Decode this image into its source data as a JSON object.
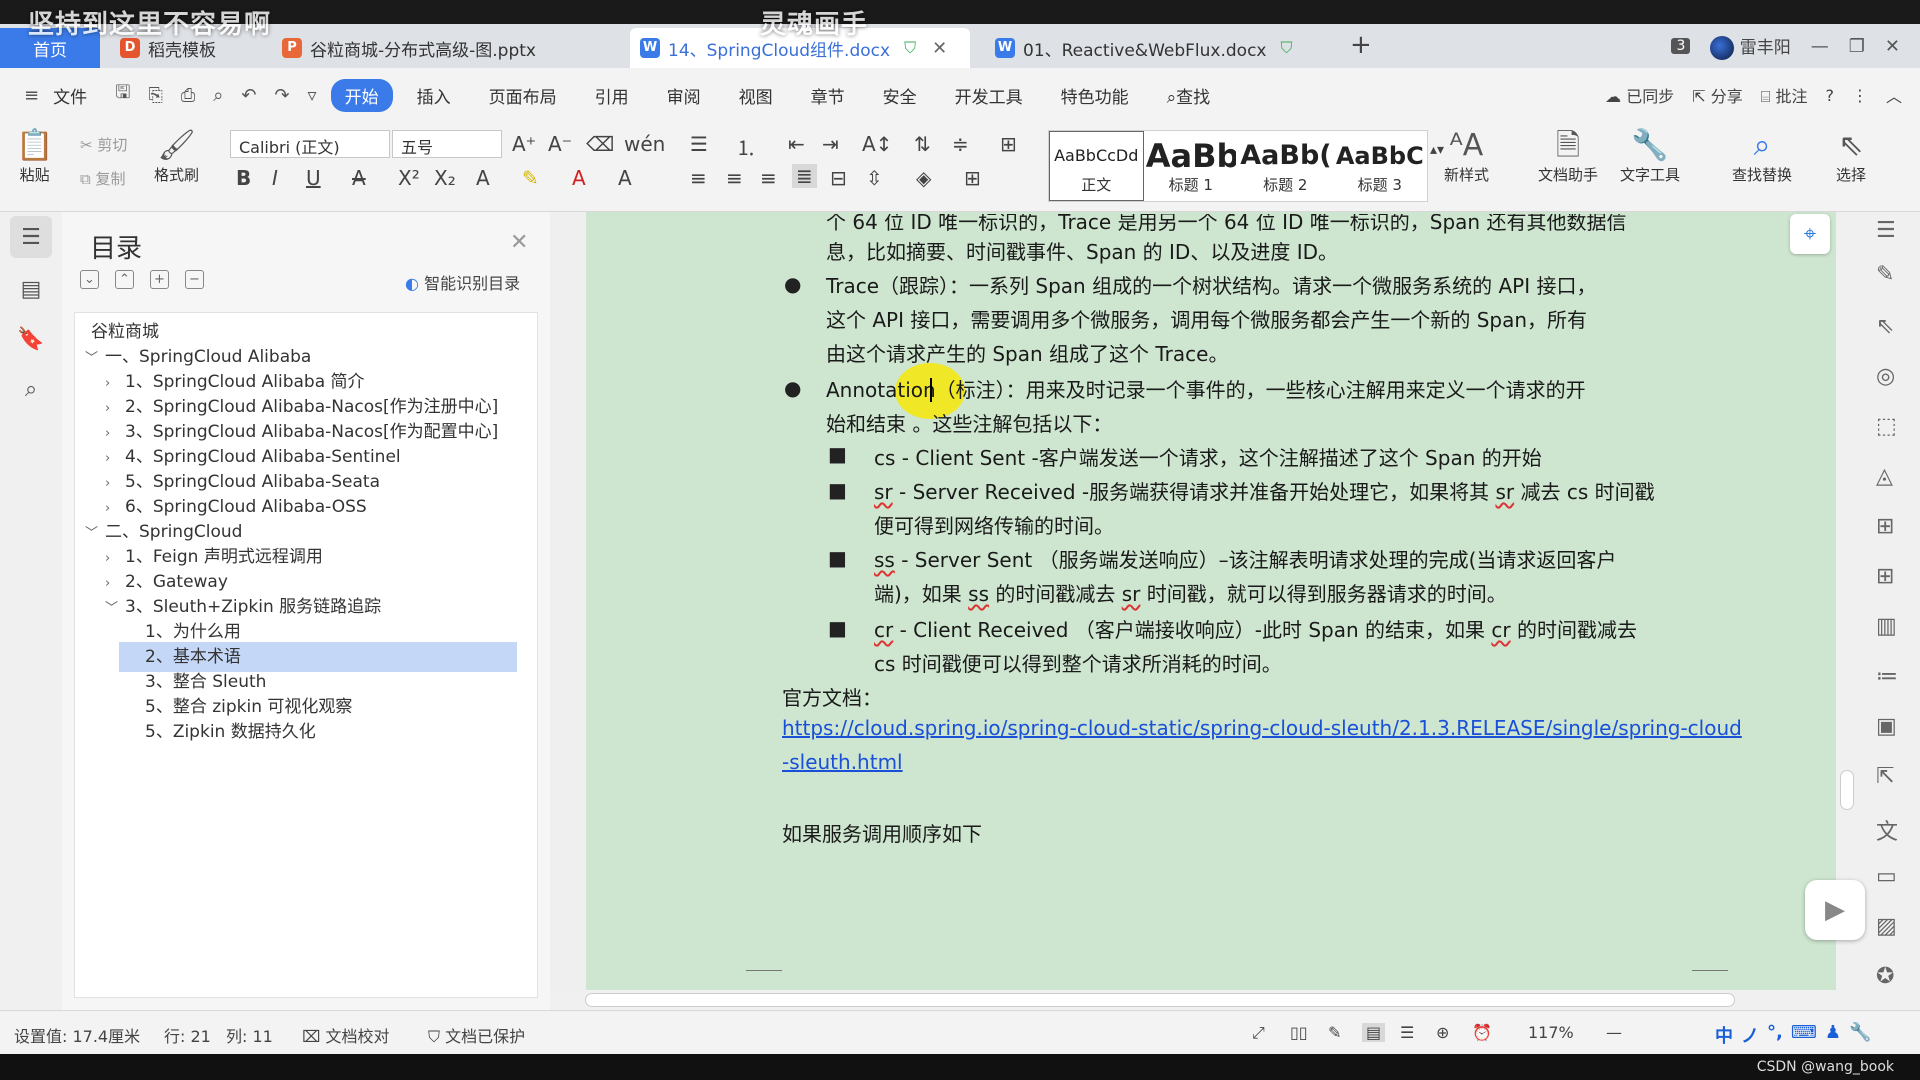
{
  "overlay": {
    "left_text": "坚持到这里不容易啊",
    "center_text": "灵魂画手"
  },
  "tabs": {
    "home": "首页",
    "items": [
      {
        "label": "稻壳模板",
        "icon_color": "#e5542c",
        "icon": "D"
      },
      {
        "label": "谷粒商城-分布式高级-图.pptx",
        "icon_color": "#e8683a",
        "icon": "P"
      },
      {
        "label": "14、SpringCloud组件.docx",
        "icon_color": "#3b7be9",
        "icon": "W",
        "active": true
      },
      {
        "label": "01、Reactive&WebFlux.docx",
        "icon_color": "#3b7be9",
        "icon": "W"
      }
    ],
    "counter": "3",
    "user": "雷丰阳"
  },
  "menu": {
    "file": "文件",
    "items": [
      "开始",
      "插入",
      "页面布局",
      "引用",
      "审阅",
      "视图",
      "章节",
      "安全",
      "开发工具",
      "特色功能",
      "查找"
    ],
    "active": "开始",
    "right": {
      "sync": "已同步",
      "share": "分享",
      "comment": "批注"
    }
  },
  "ribbon": {
    "paste": "粘贴",
    "cut": "剪切",
    "copy": "复制",
    "format_painter": "格式刷",
    "font_name": "Calibri (正文)",
    "font_size": "五号",
    "styles": [
      {
        "preview": "AaBbCcDd",
        "label": "正文"
      },
      {
        "preview": "AaBb",
        "label": "标题 1"
      },
      {
        "preview": "AaBb(",
        "label": "标题 2"
      },
      {
        "preview": "AaBbC",
        "label": "标题 3"
      }
    ],
    "new_style": "新样式",
    "doc_assistant": "文档助手",
    "text_tools": "文字工具",
    "find_replace": "查找替换",
    "select": "选择"
  },
  "toc": {
    "title": "目录",
    "smart": "智能识别目录",
    "items": [
      {
        "label": "谷粒商城",
        "level": 0,
        "caret": ""
      },
      {
        "label": "一、SpringCloud Alibaba",
        "level": 0,
        "caret": "﹀"
      },
      {
        "label": "1、SpringCloud Alibaba 简介",
        "level": 1,
        "caret": "›"
      },
      {
        "label": "2、SpringCloud Alibaba-Nacos[作为注册中心]",
        "level": 1,
        "caret": "›"
      },
      {
        "label": "3、SpringCloud Alibaba-Nacos[作为配置中心]",
        "level": 1,
        "caret": "›"
      },
      {
        "label": "4、SpringCloud Alibaba-Sentinel",
        "level": 1,
        "caret": "›"
      },
      {
        "label": "5、SpringCloud Alibaba-Seata",
        "level": 1,
        "caret": "›"
      },
      {
        "label": "6、SpringCloud Alibaba-OSS",
        "level": 1,
        "caret": "›"
      },
      {
        "label": "二、SpringCloud",
        "level": 0,
        "caret": "﹀"
      },
      {
        "label": "1、Feign 声明式远程调用",
        "level": 1,
        "caret": "›"
      },
      {
        "label": "2、Gateway",
        "level": 1,
        "caret": "›"
      },
      {
        "label": "3、Sleuth+Zipkin 服务链路追踪",
        "level": 1,
        "caret": "﹀"
      },
      {
        "label": "1、为什么用",
        "level": 2,
        "caret": ""
      },
      {
        "label": "2、基本术语",
        "level": 2,
        "caret": "",
        "selected": true
      },
      {
        "label": "3、整合 Sleuth",
        "level": 2,
        "caret": ""
      },
      {
        "label": "5、整合 zipkin 可视化观察",
        "level": 2,
        "caret": ""
      },
      {
        "label": "5、Zipkin 数据持久化",
        "level": 2,
        "caret": ""
      }
    ]
  },
  "doc": {
    "line0": "个 64 位 ID 唯一标识的，Trace 是用另一个 64 位 ID 唯一标识的，Span 还有其他数据信",
    "line1": "息，比如摘要、时间戳事件、Span 的 ID、以及进度 ID。",
    "trace_1": "Trace（跟踪）：一系列 Span 组成的一个树状结构。请求一个微服务系统的 API 接口，",
    "trace_2": "这个 API 接口，需要调用多个微服务，调用每个微服务都会产生一个新的 Span，所有",
    "trace_3": "由这个请求产生的 Span 组成了这个 Trace。",
    "ann_1": "Annotation（标注）：用来及时记录一个事件的，一些核心注解用来定义一个请求的开",
    "ann_2": "始和结束 。这些注解包括以下：",
    "cs": "cs - Client Sent -客户端发送一个请求，这个注解描述了这个 Span 的开始",
    "sr_1a": "sr",
    "sr_1b": " - Server Received -服务端获得请求并准备开始处理它，如果将其 ",
    "sr_1c": "sr",
    "sr_1d": " 减去 cs 时间戳",
    "sr_2": "便可得到网络传输的时间。",
    "ss_1a": "ss",
    "ss_1b": " - Server Sent （服务端发送响应）–该注解表明请求处理的完成(当请求返回客户",
    "ss_2a": "端)，如果 ",
    "ss_2b": "ss",
    "ss_2c": " 的时间戳减去 ",
    "ss_2d": "sr",
    "ss_2e": " 时间戳，就可以得到服务器请求的时间。",
    "cr_1a": "cr",
    "cr_1b": " - Client Received （客户端接收响应）-此时 Span 的结束，如果 ",
    "cr_1c": "cr",
    "cr_1d": " 的时间戳减去",
    "cr_2": "cs 时间戳便可以得到整个请求所消耗的时间。",
    "official": "官方文档：",
    "url_1": "https://cloud.spring.io/spring-cloud-static/spring-cloud-sleuth/2.1.3.RELEASE/single/spring-cloud",
    "url_2": "-sleuth.html",
    "call_order": "如果服务调用顺序如下"
  },
  "status": {
    "setting": "设置值: 17.4厘米",
    "row": "行: 21",
    "col": "列: 11",
    "proofread": "文档校对",
    "protected": "文档已保护",
    "zoom": "117%"
  },
  "ime": [
    "中",
    "ノ",
    "°,",
    "⌨",
    "♟",
    "🔧"
  ],
  "watermark": "CSDN @wang_book"
}
